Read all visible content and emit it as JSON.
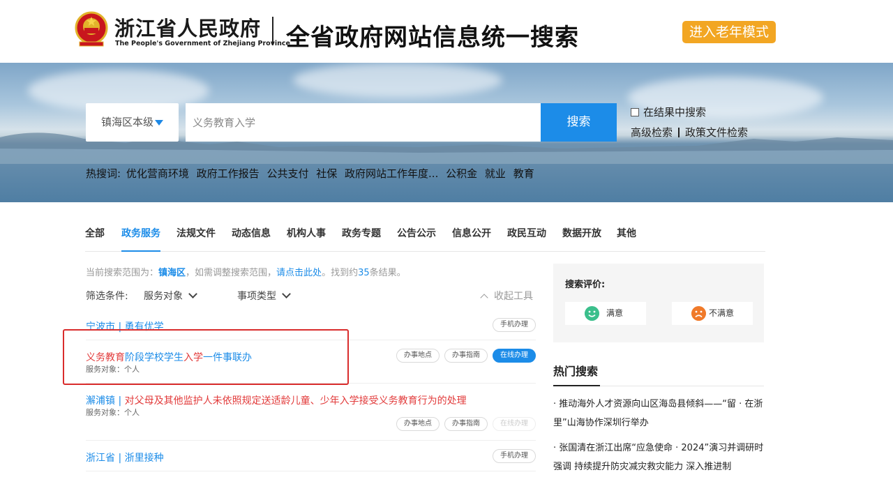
{
  "header": {
    "gov_name_cn": "浙江省人民政府",
    "gov_name_en": "The People's Government of Zhejiang Province",
    "site_title": "全省政府网站信息统一搜索",
    "elder_mode_label": "进入老年模式"
  },
  "search": {
    "region_label": "镇海区本级",
    "query": "义务教育入学",
    "button_label": "搜索",
    "in_result_label": "在结果中搜索",
    "advanced_label": "高级检索",
    "policy_label": "政策文件检索"
  },
  "hot_words": {
    "label": "热搜词:",
    "items": [
      "优化营商环境",
      "政府工作报告",
      "公共支付",
      "社保",
      "政府网站工作年度...",
      "公积金",
      "就业",
      "教育"
    ]
  },
  "tabs": [
    {
      "label": "全部"
    },
    {
      "label": "政务服务"
    },
    {
      "label": "法规文件"
    },
    {
      "label": "动态信息"
    },
    {
      "label": "机构人事"
    },
    {
      "label": "政务专题"
    },
    {
      "label": "公告公示"
    },
    {
      "label": "信息公开"
    },
    {
      "label": "政民互动"
    },
    {
      "label": "数据开放"
    },
    {
      "label": "其他"
    }
  ],
  "active_tab": "政务服务",
  "scope": {
    "prefix": "当前搜索范围为：",
    "region": "镇海区",
    "mid": "，如需调整搜索范围，",
    "link": "请点击此处",
    "count_prefix": "。找到约",
    "count": "35",
    "count_suffix": "条结果。"
  },
  "filter": {
    "label": "筛选条件:",
    "service_target": "服务对象",
    "item_type": "事项类型",
    "collapse": "收起工具"
  },
  "results": [
    {
      "title_plain": "宁波市 | 勇有优学",
      "sub": "",
      "buttons": [
        "手机办理"
      ]
    },
    {
      "title_r1": "义务教育",
      "title_b1": "阶段学校学生",
      "title_r2": "入学",
      "title_b2": "一件事联办",
      "sub": "服务对象：个人",
      "buttons": [
        "办事地点",
        "办事指南",
        "在线办理"
      ]
    },
    {
      "title_prefix": "澥浦镇 | ",
      "title_red": "对父母及其他监护人未依照规定送适龄儿童、少年入学接受义务教育行为的处理",
      "sub": "服务对象：个人",
      "buttons": [
        "办事地点",
        "办事指南",
        "在线办理"
      ]
    },
    {
      "title_plain": "浙江省 | 浙里接种",
      "sub": "",
      "buttons": [
        "手机办理"
      ]
    }
  ],
  "evaluation": {
    "title": "搜索评价:",
    "satisfied": "满意",
    "unsatisfied": "不满意"
  },
  "hot_search": {
    "title": "热门搜索",
    "items": [
      "· 推动海外人才资源向山区海岛县倾斜——“留 · 在浙里”山海协作深圳行举办",
      "· 张国清在浙江出席“应急使命 · 2024”演习并调研时强调 持续提升防灾减灾救灾能力 深入推进制"
    ]
  },
  "colors": {
    "accent": "#1c8ce8",
    "elder_button": "#f2a623",
    "highlight_red": "#e23b3b"
  }
}
